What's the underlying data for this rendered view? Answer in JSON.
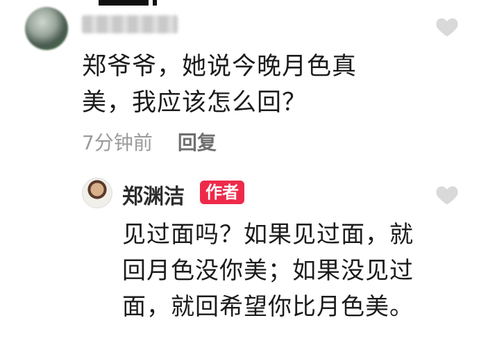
{
  "comment": {
    "text": "郑爷爷，她说今晚月色真美，我应该怎么回？",
    "time": "7分钟前",
    "reply_label": "回复"
  },
  "reply": {
    "author": "郑渊洁",
    "badge": "作者",
    "text": "见过面吗？如果见过面，就回月色没你美；如果没见过面，就回希望你比月色美。"
  },
  "icons": {
    "like": "heart-icon",
    "like_color": "#d9d9d9"
  }
}
